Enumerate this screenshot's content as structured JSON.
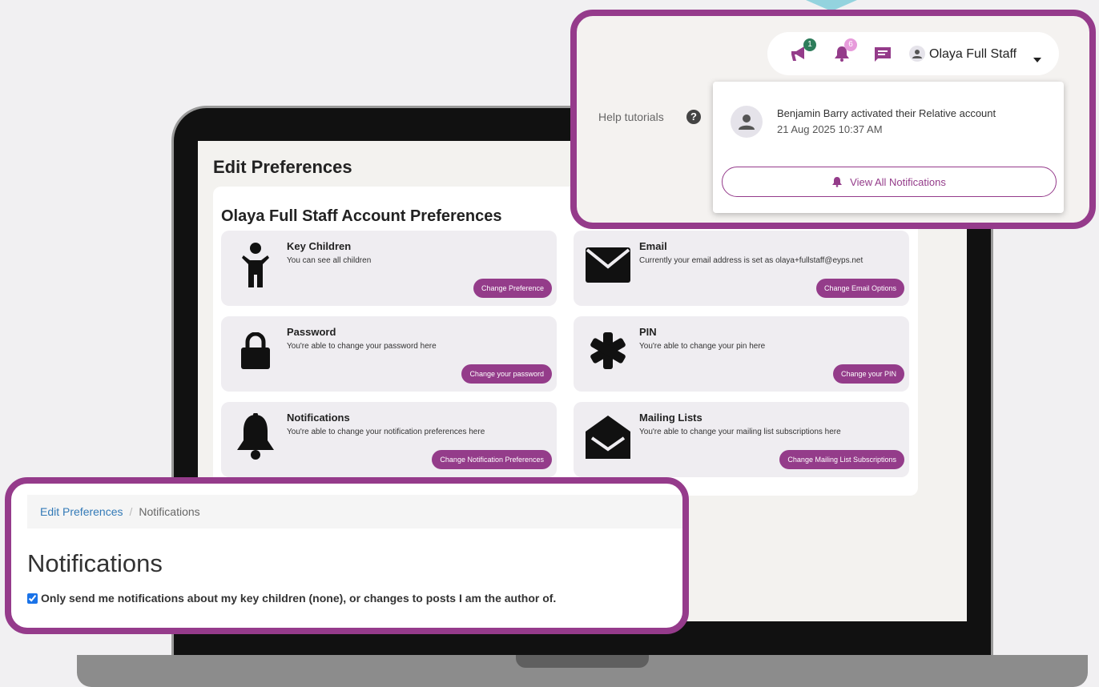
{
  "edit_preferences": {
    "title": "Edit Preferences",
    "account_heading": "Olaya Full Staff Account Preferences",
    "items": [
      {
        "title": "Key Children",
        "description": "You can see all children",
        "button": "Change Preference",
        "icon": "child-icon"
      },
      {
        "title": "Email",
        "description": "Currently your email address is set as olaya+fullstaff@eyps.net",
        "button": "Change Email Options",
        "icon": "envelope-icon"
      },
      {
        "title": "Password",
        "description": "You're able to change your password here",
        "button": "Change your password",
        "icon": "lock-icon"
      },
      {
        "title": "PIN",
        "description": "You're able to change your pin here",
        "button": "Change your PIN",
        "icon": "asterisk-icon"
      },
      {
        "title": "Notifications",
        "description": "You're able to change your notification preferences here",
        "button": "Change Notification Preferences",
        "icon": "bell-icon"
      },
      {
        "title": "Mailing Lists",
        "description": "You're able to change your mailing list subscriptions here",
        "button": "Change Mailing List Subscriptions",
        "icon": "open-envelope-icon"
      }
    ]
  },
  "topbar": {
    "announcements_count": "1",
    "notifications_count": "6",
    "user_name": "Olaya Full Staff",
    "help_label": "Help tutorials",
    "accent": "#943c8a"
  },
  "notification_dropdown": {
    "message": "Benjamin Barry activated their Relative account",
    "time": "21 Aug 2025 10:37 AM",
    "view_all_label": "View All Notifications"
  },
  "notifications_page": {
    "breadcrumb_parent": "Edit Preferences",
    "breadcrumb_separator": "/",
    "breadcrumb_current": "Notifications",
    "title": "Notifications",
    "checkbox_label": "Only send me notifications about my key children (none), or changes to posts I am the author of.",
    "checkbox_checked": true
  }
}
